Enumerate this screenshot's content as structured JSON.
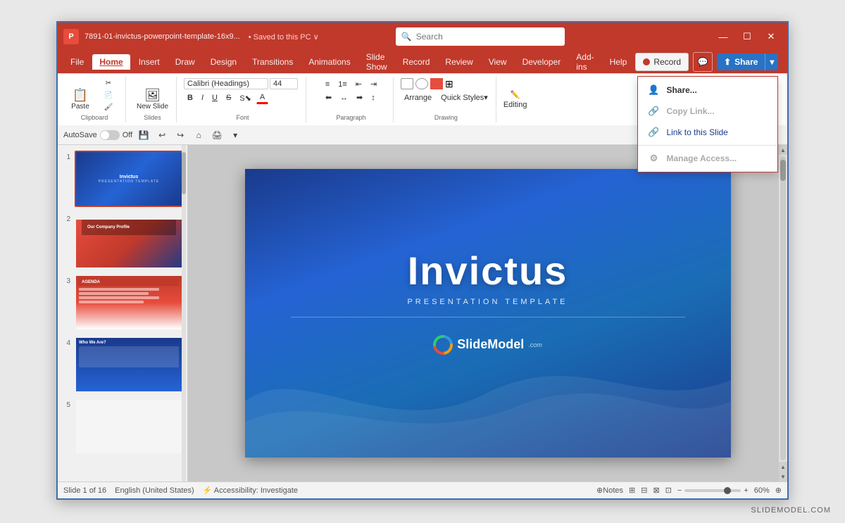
{
  "watermark": "SLIDEMODEL.COM",
  "titlebar": {
    "filename": "7891-01-invictus-powerpoint-template-16x9...",
    "saved": "• Saved to this PC ∨",
    "search_placeholder": "Search",
    "minimize": "—",
    "maximize": "☐",
    "close": "✕"
  },
  "ribbon": {
    "tabs": [
      "File",
      "Home",
      "Insert",
      "Draw",
      "Design",
      "Transitions",
      "Animations",
      "Slide Show",
      "Record",
      "Review",
      "View",
      "Developer",
      "Add-ins",
      "Help"
    ],
    "active_tab": "Home",
    "groups": {
      "clipboard": "Clipboard",
      "slides": "Slides",
      "font": "Font",
      "paragraph": "Paragraph",
      "drawing": "Drawing"
    },
    "paste_label": "Paste",
    "new_slide_label": "New Slide",
    "editing_label": "Editing",
    "record_label": "Record",
    "share_label": "Share"
  },
  "quickaccess": {
    "autosave": "AutoSave",
    "off": "Off"
  },
  "slides": [
    {
      "number": "1",
      "active": true
    },
    {
      "number": "2",
      "active": false
    },
    {
      "number": "3",
      "active": false
    },
    {
      "number": "4",
      "active": false
    },
    {
      "number": "5",
      "active": false
    }
  ],
  "slide_content": {
    "title": "Invictus",
    "subtitle": "PRESENTATION TEMPLATE",
    "logo_text": "SlideModel",
    "logo_com": ".com"
  },
  "share_dropdown": {
    "items": [
      {
        "label": "Share...",
        "icon": "👤",
        "disabled": false
      },
      {
        "label": "Copy Link...",
        "icon": "🔗",
        "disabled": true
      },
      {
        "label": "Link to this Slide",
        "icon": "🔗",
        "disabled": false,
        "active": true
      },
      {
        "label": "Manage Access...",
        "icon": "⚙",
        "disabled": true
      }
    ]
  },
  "statusbar": {
    "slide_info": "Slide 1 of 16",
    "language": "English (United States)",
    "accessibility": "⚡ Accessibility: Investigate",
    "notes": "⊕Notes",
    "zoom": "60%"
  }
}
